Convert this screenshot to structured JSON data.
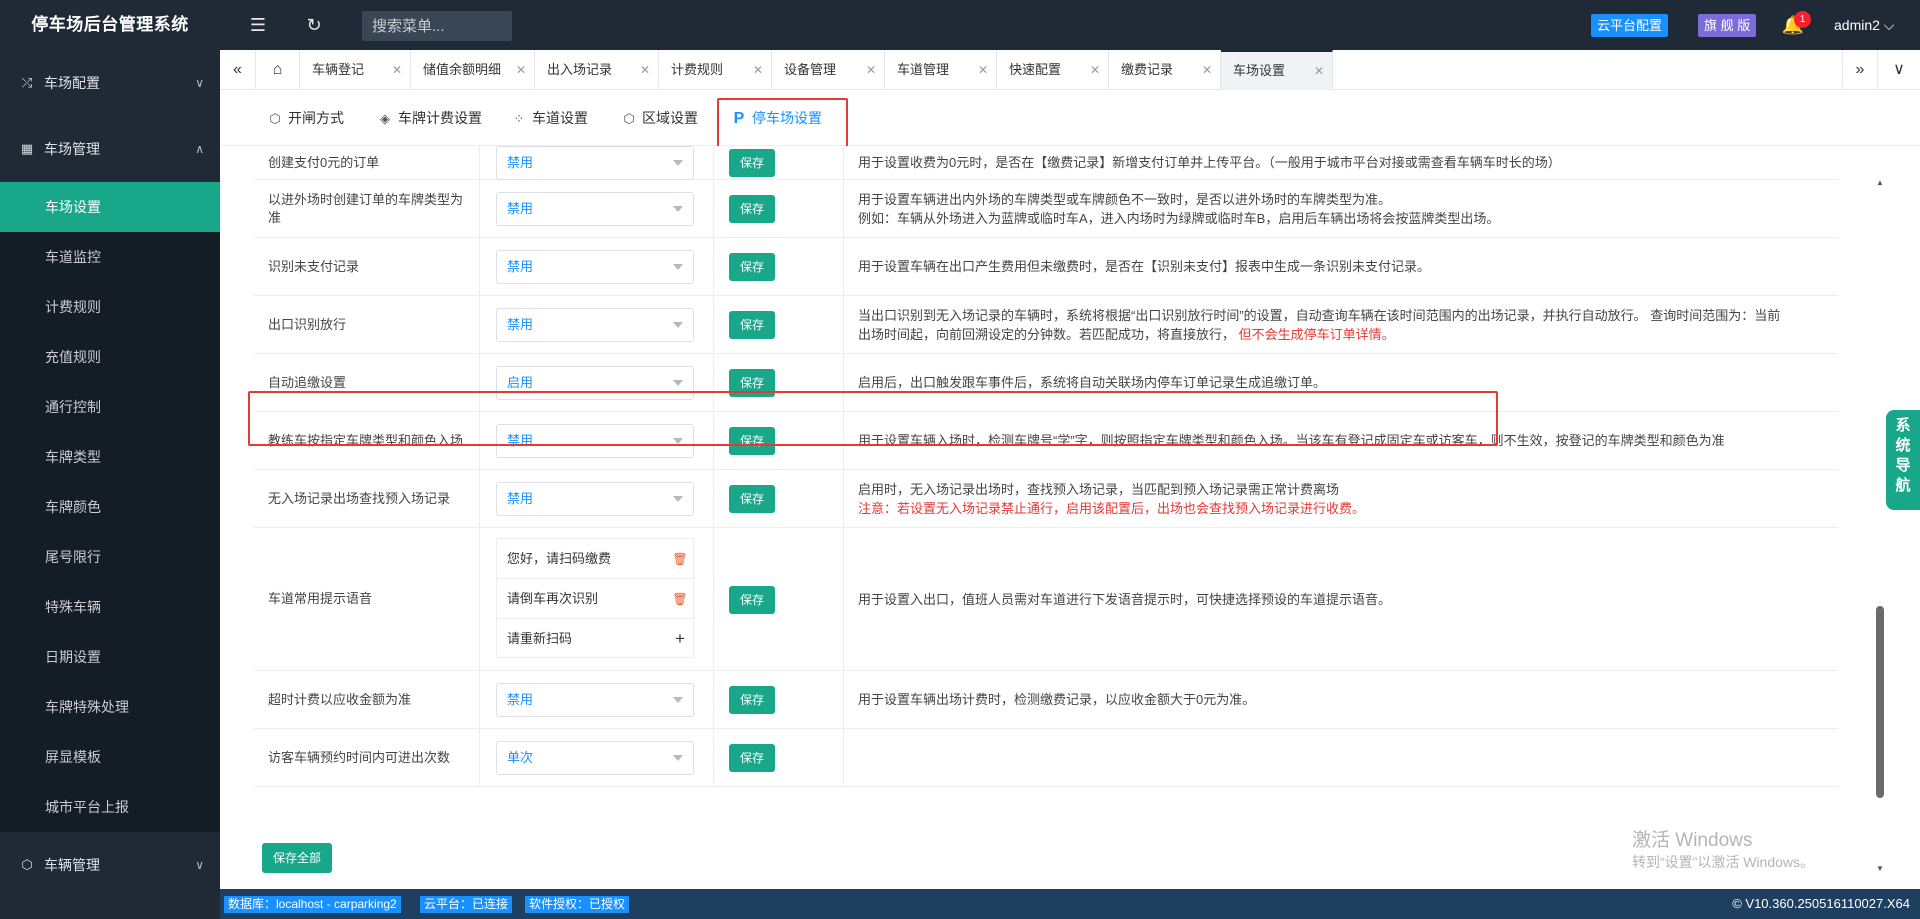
{
  "app": {
    "title": "停车场后台管理系统",
    "search_placeholder": "搜索菜单...",
    "cloud_btn": "云平台配置",
    "edition_btn": "旗 舰 版",
    "notification_count": "1",
    "user": "admin2"
  },
  "sidebar": {
    "groups": [
      {
        "label": "车场配置",
        "icon": "shuffle-icon"
      },
      {
        "label": "车场管理",
        "icon": "grid-icon"
      },
      {
        "label": "车辆管理",
        "icon": "cube-icon"
      }
    ],
    "items": [
      "车场设置",
      "车道监控",
      "计费规则",
      "充值规则",
      "通行控制",
      "车牌类型",
      "车牌颜色",
      "尾号限行",
      "特殊车辆",
      "日期设置",
      "车牌特殊处理",
      "屏显模板",
      "城市平台上报"
    ],
    "active_item": "车场设置"
  },
  "tabs": [
    "车辆登记",
    "储值余额明细",
    "出入场记录",
    "计费规则",
    "设备管理",
    "车道管理",
    "快速配置",
    "缴费记录",
    "车场设置"
  ],
  "active_tab": "车场设置",
  "subtabs": [
    "开闸方式",
    "车牌计费设置",
    "车道设置",
    "区域设置",
    "停车场设置"
  ],
  "active_subtab": "停车场设置",
  "save_label": "保存",
  "save_all_label": "保存全部",
  "rows": [
    {
      "label": "创建支付0元的订单",
      "value": "禁用",
      "desc1": "用于设置收费为0元时，是否在【缴费记录】新增支付订单并上传平台。（一般用于城市平台对接或需查看车辆车时长的场）",
      "desc2": "",
      "desc_red": ""
    },
    {
      "label": "以进外场时创建订单的车牌类型为准",
      "value": "禁用",
      "desc1": "用于设置车辆进出内外场的车牌类型或车牌颜色不一致时，是否以进外场时的车牌类型为准。",
      "desc2": "例如：车辆从外场进入为蓝牌或临时车A，进入内场时为绿牌或临时车B，启用后车辆出场将会按蓝牌类型出场。",
      "desc_red": ""
    },
    {
      "label": "识别未支付记录",
      "value": "禁用",
      "desc1": "用于设置车辆在出口产生费用但未缴费时，是否在【识别未支付】报表中生成一条识别未支付记录。",
      "desc2": "",
      "desc_red": ""
    },
    {
      "label": "出口识别放行",
      "value": "禁用",
      "desc1": "当出口识别到无入场记录的车辆时，系统将根据“出口识别放行时间”的设置，自动查询车辆在该时间范围内的出场记录，并执行自动放行。 查询时间范围为：当前",
      "desc2": "出场时间起，向前回溯设定的分钟数。若匹配成功，将直接放行，",
      "desc_red": "但不会生成停车订单详情。"
    },
    {
      "label": "自动追缴设置",
      "value": "启用",
      "desc1": "启用后，出口触发跟车事件后，系统将自动关联场内停车订单记录生成追缴订单。",
      "desc2": "",
      "desc_red": ""
    },
    {
      "label": "教练车按指定车牌类型和颜色入场",
      "value": "禁用",
      "desc1": "用于设置车辆入场时，检测车牌号“学”字，则按照指定车牌类型和颜色入场。当该车有登记成固定车或访客车，则不生效，按登记的车牌类型和颜色为准",
      "desc2": "",
      "desc_red": ""
    },
    {
      "label": "无入场记录出场查找预入场记录",
      "value": "禁用",
      "desc1": "启用时，无入场记录出场时，查找预入场记录，当匹配到预入场记录需正常计费离场",
      "desc2": "",
      "desc_red": "注意：若设置无入场记录禁止通行，启用该配置后，出场也会查找预入场记录进行收费。"
    },
    {
      "label": "车道常用提示语音",
      "value": "",
      "desc1": "用于设置入出口，值班人员需对车道进行下发语音提示时，可快捷选择预设的车道提示语音。",
      "desc2": "",
      "desc_red": ""
    },
    {
      "label": "超时计费以应收金额为准",
      "value": "禁用",
      "desc1": "用于设置车辆出场计费时，检测缴费记录，以应收金额大于0元为准。",
      "desc2": "",
      "desc_red": ""
    },
    {
      "label": "访客车辆预约时间内可进出次数",
      "value": "单次",
      "desc1": "",
      "desc2": "",
      "desc_red": ""
    }
  ],
  "voices": [
    "您好，请扫码缴费",
    "请倒车再次识别",
    "请重新扫码"
  ],
  "sys_nav": "系统导航",
  "watermark": {
    "line1": "激活 Windows",
    "line2": "转到“设置”以激活 Windows。"
  },
  "status": {
    "db": "数据库：localhost - carparking2",
    "cloud": "云平台：已连接",
    "license": "软件授权：已授权",
    "version": "© V10.360.250516110027.X64"
  },
  "colors": {
    "accent": "#19a78a",
    "sidebar_bg": "#1f2a36",
    "link": "#1890ff",
    "alert": "#e53935"
  }
}
